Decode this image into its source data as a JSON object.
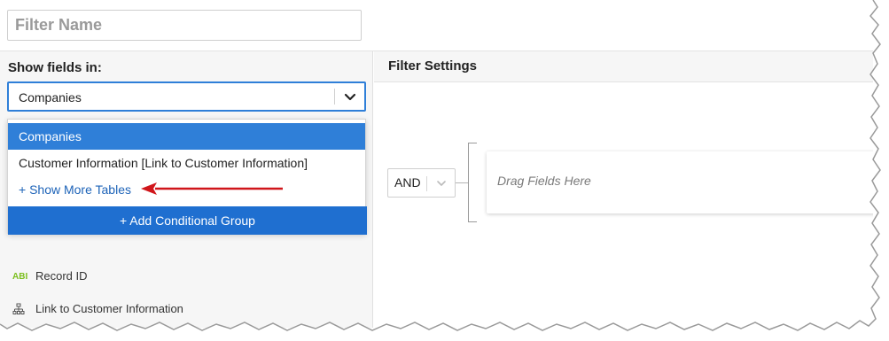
{
  "filter_name": {
    "placeholder": "Filter Name"
  },
  "left_panel": {
    "show_fields_label": "Show fields in:",
    "table_select": {
      "value": "Companies"
    },
    "dropdown": {
      "options": [
        "Companies",
        "Customer Information [Link to Customer Information]"
      ],
      "show_more": "+ Show More Tables"
    },
    "add_group_label": "+ Add Conditional Group",
    "fields": [
      {
        "icon": "text-field-icon",
        "icon_glyph": "ABI",
        "label": "Record ID"
      },
      {
        "icon": "hierarchy-icon",
        "icon_glyph": "",
        "label": "Link to Customer Information"
      }
    ]
  },
  "right_panel": {
    "title": "Filter Settings",
    "logic_select": {
      "value": "AND"
    },
    "drop_zone": "Drag Fields Here"
  },
  "colors": {
    "accent": "#2f7fd8",
    "button": "#1f6fd0",
    "link": "#1d63b8",
    "annotation_arrow": "#d0161b",
    "text_field_icon": "#7cbf1e"
  }
}
